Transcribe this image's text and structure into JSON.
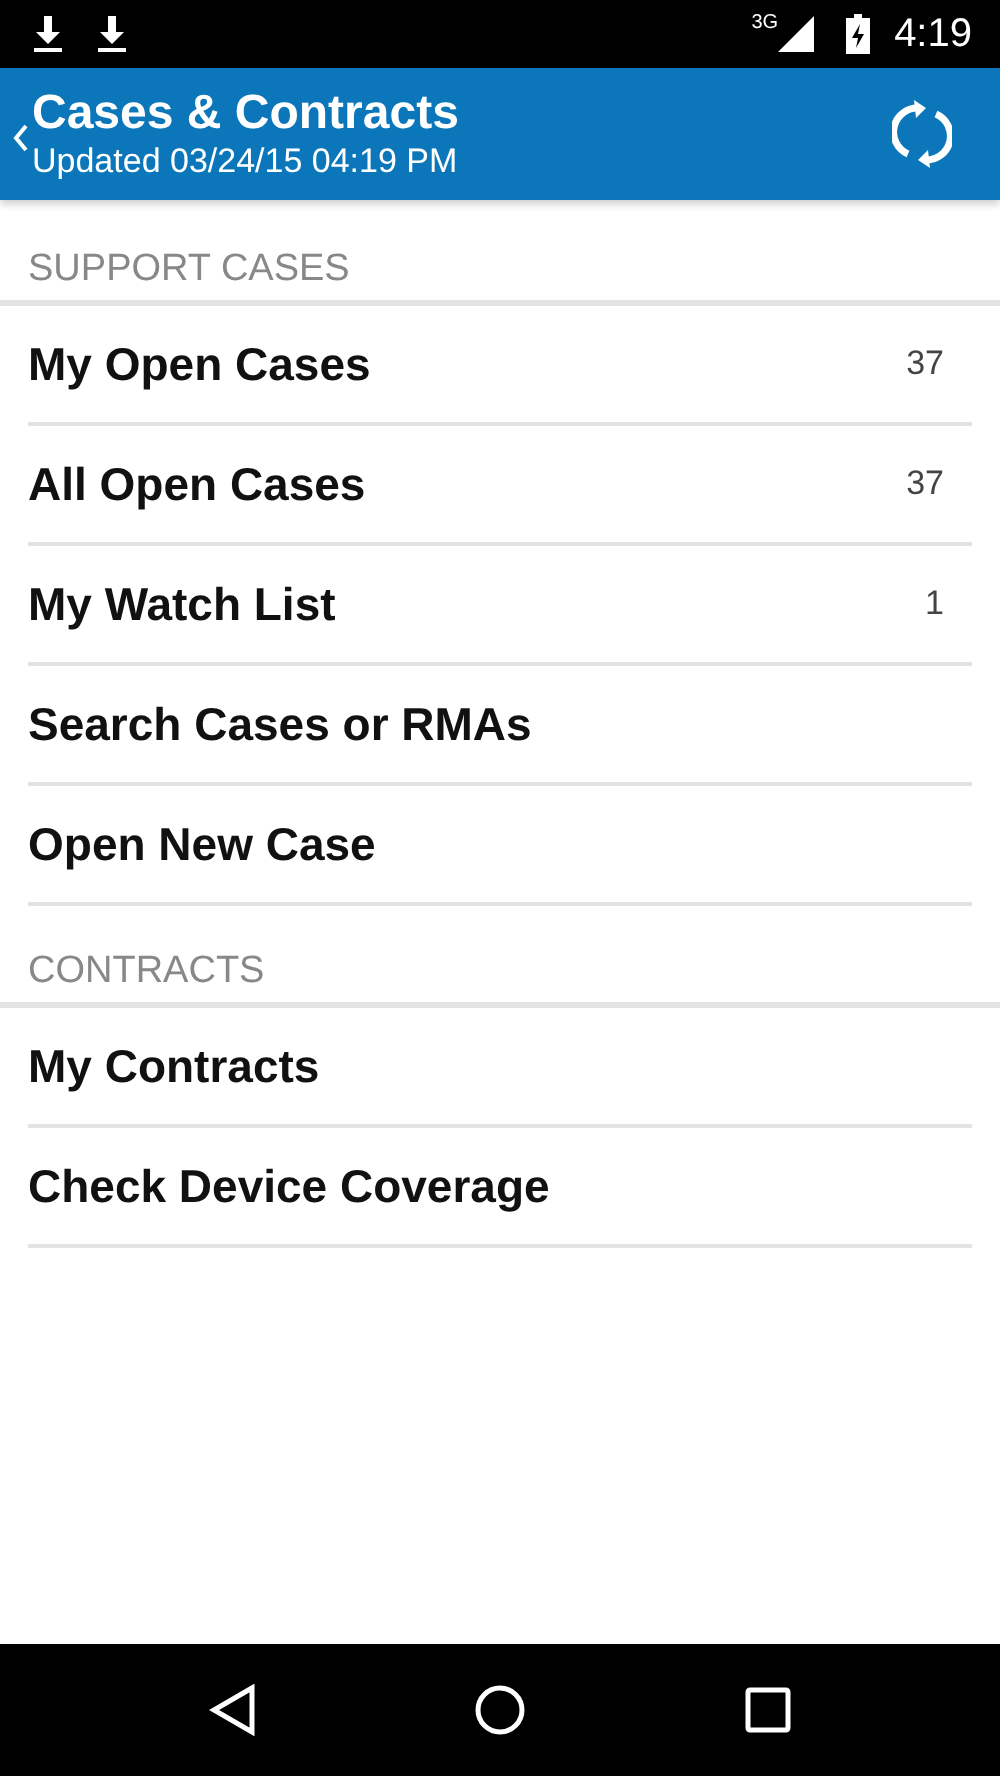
{
  "status_bar": {
    "network": "3G",
    "time": "4:19"
  },
  "app_bar": {
    "title": "Cases & Contracts",
    "subtitle": "Updated 03/24/15 04:19 PM"
  },
  "sections": [
    {
      "header": "SUPPORT CASES",
      "items": [
        {
          "label": "My Open Cases",
          "count": "37"
        },
        {
          "label": "All Open Cases",
          "count": "37"
        },
        {
          "label": "My Watch List",
          "count": "1"
        },
        {
          "label": "Search Cases or RMAs"
        },
        {
          "label": "Open New Case"
        }
      ]
    },
    {
      "header": "CONTRACTS",
      "items": [
        {
          "label": "My Contracts"
        },
        {
          "label": "Check Device Coverage"
        }
      ]
    }
  ]
}
